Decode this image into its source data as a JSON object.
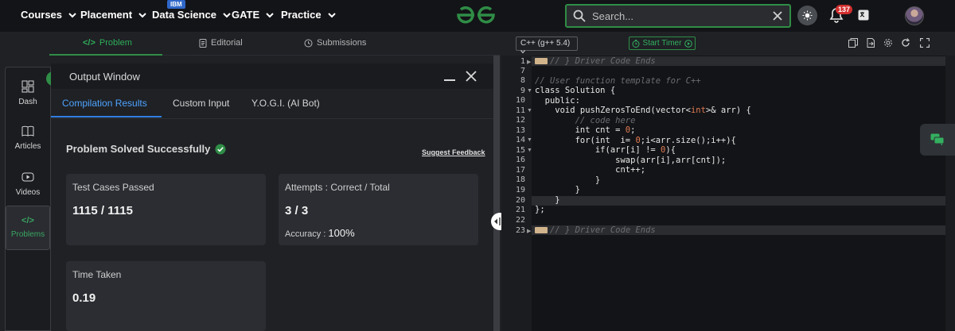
{
  "nav": {
    "items": [
      "Courses",
      "Placement",
      "Data Science",
      "GATE",
      "Practice"
    ],
    "badge": "IBM",
    "search_placeholder": "Search...",
    "notifications": "137"
  },
  "tabs": {
    "problem": "Problem",
    "editorial": "Editorial",
    "submissions": "Submissions"
  },
  "sidebar": {
    "items": [
      "Dash",
      "Articles",
      "Videos",
      "Problems"
    ]
  },
  "output": {
    "title": "Output Window",
    "tabs": [
      "Compilation Results",
      "Custom Input",
      "Y.O.G.I. (AI Bot)"
    ],
    "status": "Problem Solved Successfully",
    "feedback": "Suggest Feedback",
    "test_cases_label": "Test Cases Passed",
    "test_cases_value": "1115 / 1115",
    "attempts_label": "Attempts : Correct / Total",
    "attempts_value": "3 / 3",
    "accuracy_label": "Accuracy :",
    "accuracy_value": "100%",
    "time_label": "Time Taken",
    "time_value": "0.19"
  },
  "editor": {
    "language": "C++ (g++ 5.4)",
    "timer": "Start Timer",
    "line_numbers": [
      "1",
      "7",
      "8",
      "9",
      "10",
      "11",
      "12",
      "13",
      "14",
      "15",
      "16",
      "17",
      "18",
      "19",
      "20",
      "21",
      "22",
      "23"
    ],
    "lines": {
      "l1": "// } Driver Code Ends",
      "l8": "// User function template for C++",
      "l9": "class Solution {",
      "l10": "  public:",
      "l11a": "    void pushZerosToEnd(vector<",
      "l11b": "int",
      "l11c": ">& arr) {",
      "l12": "        // code here",
      "l13a": "        int cnt = ",
      "l13b": "0",
      "l13c": ";",
      "l14a": "        for(int  i= ",
      "l14b": "0",
      "l14c": ";i<arr.size();i++){",
      "l15a": "            if(arr[i] != ",
      "l15b": "0",
      "l15c": "){",
      "l16": "                swap(arr[i],arr[cnt]);",
      "l17": "                cnt++;",
      "l18": "            }",
      "l19": "        }",
      "l20": "    }",
      "l21": "};",
      "l23": "// } Driver Code Ends"
    }
  }
}
